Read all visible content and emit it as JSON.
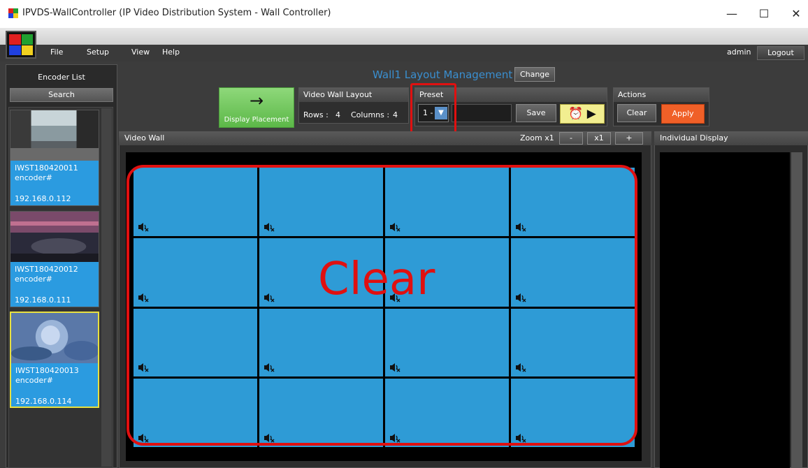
{
  "window": {
    "title": "IPVDS-WallController (IP Video Distribution System - Wall Controller)",
    "minimize": "—",
    "maximize": "☐",
    "close": "✕"
  },
  "menu": {
    "items": [
      "File",
      "Setup",
      "View",
      "Help"
    ],
    "user": "admin",
    "logout": "Logout"
  },
  "encoder_list": {
    "title": "Encoder List",
    "search": "Search",
    "encoders": [
      {
        "name": "IWST180420011",
        "type": "encoder#",
        "ip": "192.168.0.112",
        "selected": false
      },
      {
        "name": "IWST180420012",
        "type": "encoder#",
        "ip": "192.168.0.111",
        "selected": false
      },
      {
        "name": "IWST180420013",
        "type": "encoder#",
        "ip": "192.168.0.114",
        "selected": true
      }
    ]
  },
  "layout_management": {
    "title": "Wall1 Layout Management",
    "change": "Change",
    "display_placement": "Display Placement",
    "video_wall_layout": {
      "heading": "Video Wall Layout",
      "rows_label": "Rows :",
      "rows": "4",
      "columns_label": "Columns :",
      "columns": "4"
    },
    "preset": {
      "heading": "Preset",
      "selected": "1 -",
      "save": "Save"
    },
    "actions": {
      "heading": "Actions",
      "clear": "Clear",
      "apply": "Apply"
    }
  },
  "video_wall": {
    "title": "Video Wall",
    "zoom_label": "Zoom x1",
    "zoom_minus": "-",
    "zoom_x1": "x1",
    "zoom_plus": "+",
    "annotation": "Clear",
    "tile_count": 16
  },
  "individual_display": {
    "title": "Individual Display"
  },
  "colors": {
    "tile": "#2e9bd6",
    "apply": "#f06028",
    "highlight": "#e01010",
    "title_blue": "#3a8fd0"
  }
}
